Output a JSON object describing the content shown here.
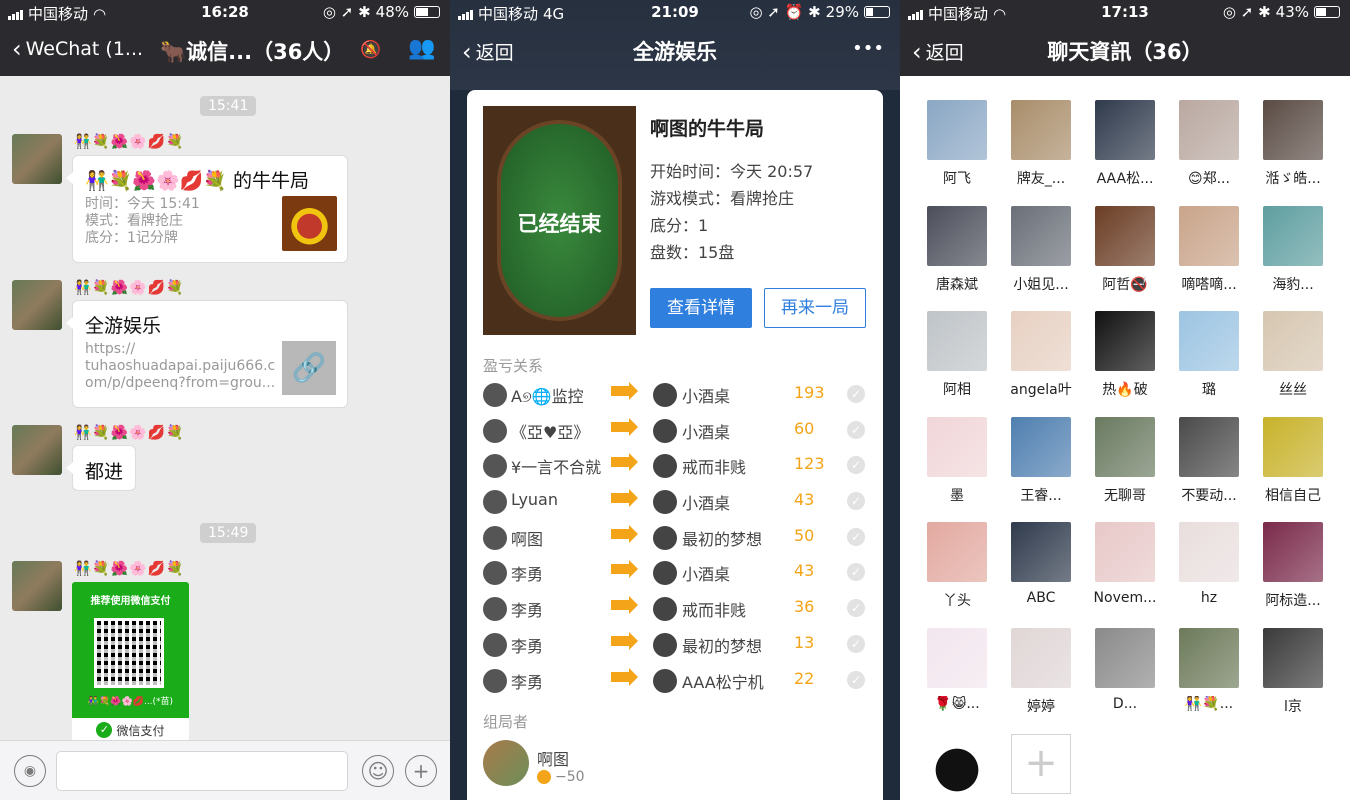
{
  "panel1": {
    "status": {
      "carrier": "中国移动",
      "time": "16:28",
      "battery": "48%"
    },
    "nav": {
      "back": "WeChat (1...",
      "title": "🐂诚信...（36人）"
    },
    "messages": [
      {
        "time": "15:41",
        "nick": "👫💐🌺🌸💋💐",
        "title": "👫💐🌺🌸💋💐 的牛牛局",
        "lines": [
          "时间：今天 15:41",
          "模式：看牌抢庄",
          "底分：1记分牌"
        ]
      },
      {
        "nick": "👫💐🌺🌸💋💐",
        "title": "全游娱乐",
        "lines": [
          "https://",
          "tuhaoshuadapai.paiju666.c",
          "om/p/dpeenq?from=grou..."
        ]
      },
      {
        "nick": "👫💐🌺🌸💋💐",
        "title": "都进"
      },
      {
        "time": "15:49",
        "nick": "👫💐🌺🌸💋💐"
      }
    ],
    "pay": {
      "header": "推荐使用微信支付",
      "footer_name": "👫💐🌺🌸💋...(*苗)",
      "brand": "微信支付"
    }
  },
  "panel2": {
    "status": {
      "carrier": "中国移动",
      "network": "4G",
      "time": "21:09",
      "battery": "29%"
    },
    "nav": {
      "back": "返回",
      "title": "全游娱乐",
      "more": "•••"
    },
    "game": {
      "state": "已经结束",
      "title": "啊图的牛牛局",
      "start": "开始时间：今天 20:57",
      "mode": "游戏模式：看牌抢庄",
      "base": "底分：1",
      "rounds": "盘数：15盘",
      "detail_btn": "查看详情",
      "again_btn": "再来一局"
    },
    "relations_label": "盈亏关系",
    "relations": [
      {
        "from": "A୭🌐监控",
        "to": "小酒桌",
        "amount": "193"
      },
      {
        "from": "《亞♥亞》",
        "to": "小酒桌",
        "amount": "60"
      },
      {
        "from": "¥一言不合就",
        "to": "戒而非贱",
        "amount": "123"
      },
      {
        "from": "Lyuan",
        "to": "小酒桌",
        "amount": "43"
      },
      {
        "from": "啊图",
        "to": "最初的梦想",
        "amount": "50"
      },
      {
        "from": "李勇",
        "to": "小酒桌",
        "amount": "43"
      },
      {
        "from": "李勇",
        "to": "戒而非贱",
        "amount": "36"
      },
      {
        "from": "李勇",
        "to": "最初的梦想",
        "amount": "13"
      },
      {
        "from": "李勇",
        "to": "AAA松宁机",
        "amount": "22"
      }
    ],
    "organizer_label": "组局者",
    "organizer": {
      "name": "啊图",
      "score": "−50"
    }
  },
  "panel3": {
    "status": {
      "carrier": "中国移动",
      "time": "17:13",
      "battery": "43%"
    },
    "nav": {
      "back": "返回",
      "title": "聊天資訊（36）"
    },
    "members": [
      {
        "name": "阿飞",
        "color": "#8aa7c4"
      },
      {
        "name": "牌友_...",
        "color": "#a98d6a"
      },
      {
        "name": "AAA松...",
        "color": "#2f3a4c"
      },
      {
        "name": "😊郑...",
        "color": "#b9a8a0"
      },
      {
        "name": "湉ゞ皓...",
        "color": "#5a4b44"
      },
      {
        "name": "唐森斌",
        "color": "#4b4e5a"
      },
      {
        "name": "小姐见...",
        "color": "#6a6f78"
      },
      {
        "name": "阿哲🚭",
        "color": "#6b3e25"
      },
      {
        "name": "嘀嗒嘀...",
        "color": "#c9a48a"
      },
      {
        "name": "海豹...",
        "color": "#5e9ea0"
      },
      {
        "name": "阿相",
        "color": "#bfc4c8"
      },
      {
        "name": "angela叶",
        "color": "#e7d0c2"
      },
      {
        "name": "热🔥破",
        "color": "#111111"
      },
      {
        "name": "璐",
        "color": "#9cc4e2"
      },
      {
        "name": "丝丝",
        "color": "#d6c6b0"
      },
      {
        "name": "墨",
        "color": "#f1d6d8"
      },
      {
        "name": "王睿...",
        "color": "#4f7fb0"
      },
      {
        "name": "无聊哥",
        "color": "#6a7a60"
      },
      {
        "name": "不要动...",
        "color": "#4a4a4a"
      },
      {
        "name": "相信自己",
        "color": "#c8b22a"
      },
      {
        "name": "丫头",
        "color": "#e2a9a0"
      },
      {
        "name": "ABC",
        "color": "#2f3a4c"
      },
      {
        "name": "Novem...",
        "color": "#e8c8c8"
      },
      {
        "name": "hz",
        "color": "#e9dede"
      },
      {
        "name": "阿标造...",
        "color": "#7a2a4a"
      },
      {
        "name": "🌹😸...",
        "color": "#f2e6ee"
      },
      {
        "name": "婷婷",
        "color": "#e0d6d6"
      },
      {
        "name": "D...",
        "color": "#8a8a8a"
      },
      {
        "name": "👫💐...",
        "color": "#6d7a5a"
      },
      {
        "name": "l京",
        "color": "#3a3a3a"
      }
    ]
  }
}
